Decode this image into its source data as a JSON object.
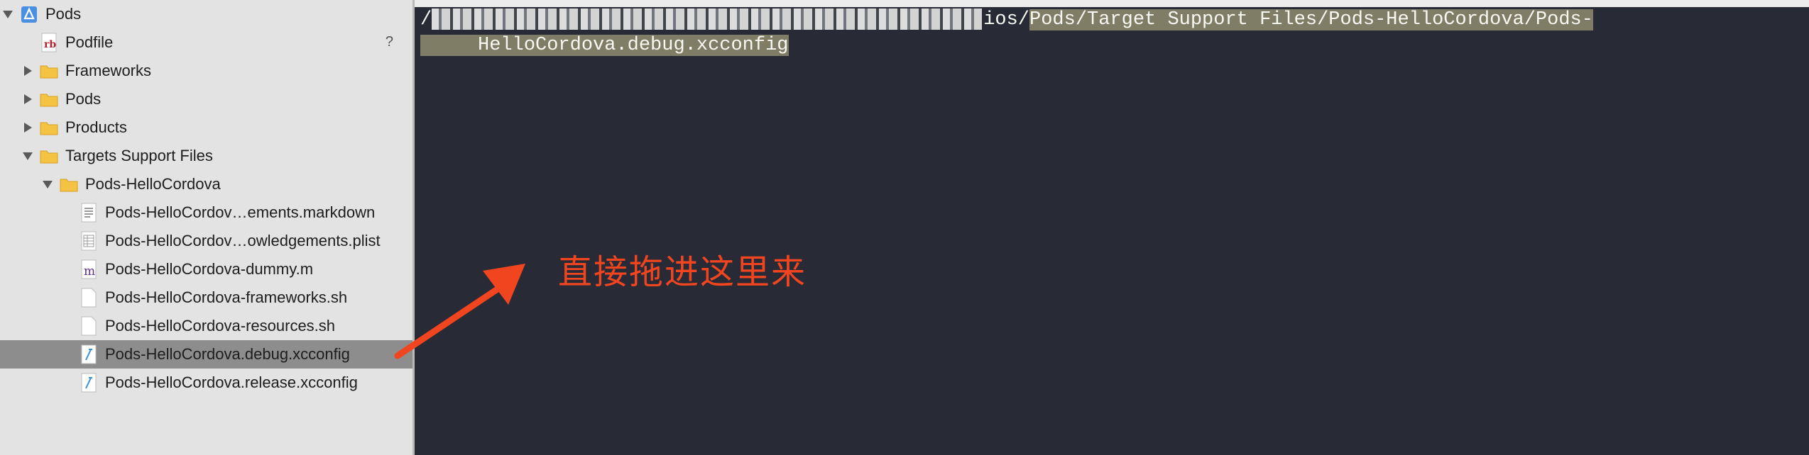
{
  "sidebar": {
    "items": [
      {
        "label": "Pods",
        "icon": "xcode-project-icon",
        "expanded": true
      },
      {
        "label": "Podfile",
        "icon": "ruby-file-icon",
        "status": "?"
      },
      {
        "label": "Frameworks",
        "icon": "folder-icon",
        "expanded": false
      },
      {
        "label": "Pods",
        "icon": "folder-icon",
        "expanded": false
      },
      {
        "label": "Products",
        "icon": "folder-icon",
        "expanded": false
      },
      {
        "label": "Targets Support Files",
        "icon": "folder-icon",
        "expanded": true
      },
      {
        "label": "Pods-HelloCordova",
        "icon": "folder-icon",
        "expanded": true
      },
      {
        "label": "Pods-HelloCordov…ements.markdown",
        "icon": "markdown-file-icon"
      },
      {
        "label": "Pods-HelloCordov…owledgements.plist",
        "icon": "plist-file-icon"
      },
      {
        "label": "Pods-HelloCordova-dummy.m",
        "icon": "objc-file-icon"
      },
      {
        "label": "Pods-HelloCordova-frameworks.sh",
        "icon": "shell-file-icon"
      },
      {
        "label": "Pods-HelloCordova-resources.sh",
        "icon": "shell-file-icon"
      },
      {
        "label": "Pods-HelloCordova.debug.xcconfig",
        "icon": "xcconfig-file-icon",
        "selected": true
      },
      {
        "label": "Pods-HelloCordova.release.xcconfig",
        "icon": "xcconfig-file-icon"
      }
    ]
  },
  "terminal": {
    "line1_prefix": "/",
    "line1_visible": "ios/",
    "line1_highlight": "Pods/Target Support Files/Pods-HelloCordova/Pods-",
    "line2_indent": "     ",
    "line2_highlight": "HelloCordova.debug.xcconfig"
  },
  "annotation": {
    "text": "直接拖进这里来",
    "color": "#f0451f"
  },
  "colors": {
    "terminal_bg": "#282a36",
    "selection_highlight": "#7f7d66",
    "sidebar_bg": "#e3e3e3",
    "selected_row": "#8d8d8d",
    "folder_yellow": "#f5c344"
  }
}
